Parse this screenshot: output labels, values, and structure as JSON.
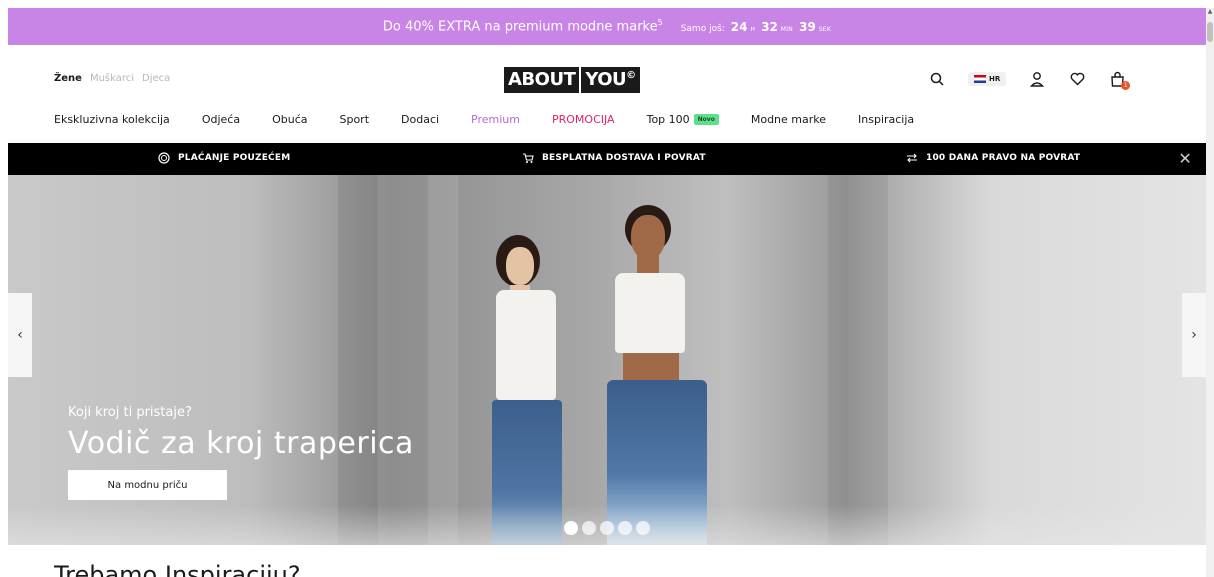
{
  "promo": {
    "text": "Do 40% EXTRA na premium modne marke",
    "sup": "5",
    "countdown_label": "Samo još:",
    "hours": "24",
    "hours_unit": "H",
    "minutes": "32",
    "minutes_unit": "MIN",
    "seconds": "39",
    "seconds_unit": "SEK",
    "background": "#c885e6"
  },
  "header": {
    "genders": [
      "Žene",
      "Muškarci",
      "Djeca"
    ],
    "logo_a": "ABOUT",
    "logo_b": "YOU",
    "logo_mark": "©",
    "lang": "HR",
    "cart_count": "1",
    "icons": [
      "search-icon",
      "user-icon",
      "heart-icon",
      "bag-icon"
    ]
  },
  "nav": {
    "items": [
      "Ekskluzivna kolekcija",
      "Odjeća",
      "Obuća",
      "Sport",
      "Dodaci",
      "Premium",
      "PROMOCIJA",
      "Top 100",
      "Modne marke",
      "Inspiracija"
    ],
    "novo_badge": "Novo",
    "premium_color": "#b36bd8",
    "promocija_color": "#e0245e"
  },
  "usp": {
    "items": [
      "PLAĆANJE POUZEĆEM",
      "BESPLATNA DOSTAVA I POVRAT",
      "100 DANA PRAVO NA POVRAT"
    ],
    "close": "✕"
  },
  "hero": {
    "subtitle": "Koji kroj ti pristaje?",
    "title": "Vodič za kroj traperica",
    "button": "Na modnu priču",
    "prev": "‹",
    "next": "›",
    "slides_total": 5,
    "active_slide": 1
  },
  "below": {
    "title": "Trebamo Inspiraciju?"
  }
}
